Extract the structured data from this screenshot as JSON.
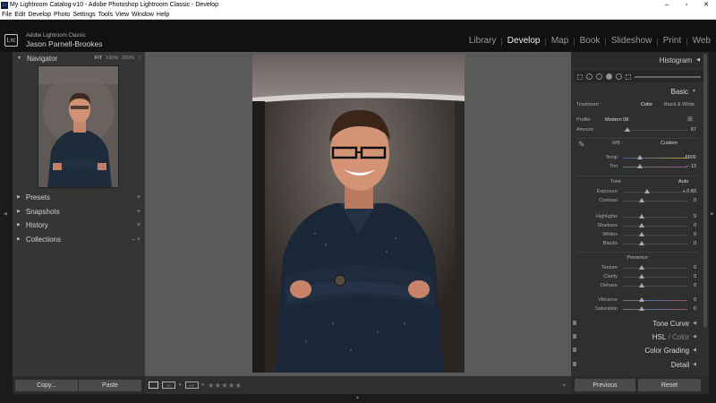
{
  "window": {
    "title": "My Lightroom Catalog-v10 - Adobe Photoshop Lightroom Classic - Develop",
    "app_icon": "Lr",
    "minimize": "–",
    "maximize": "▫",
    "close": "✕"
  },
  "menu": [
    "File",
    "Edit",
    "Develop",
    "Photo",
    "Settings",
    "Tools",
    "View",
    "Window",
    "Help"
  ],
  "identity": {
    "logo": "Lrc",
    "subtitle": "Adobe Lightroom Classic",
    "name": "Jason Parnell-Brookes"
  },
  "modules": [
    "Library",
    "Develop",
    "Map",
    "Book",
    "Slideshow",
    "Print",
    "Web"
  ],
  "modules_active": "Develop",
  "navigator": {
    "title": "Navigator",
    "zoom": [
      "FIT",
      "100%",
      "200%",
      "↕"
    ],
    "zoom_active": "FIT"
  },
  "left_sections": [
    {
      "label": "Presets",
      "action": "+"
    },
    {
      "label": "Snapshots",
      "action": "+"
    },
    {
      "label": "History",
      "action": "×"
    },
    {
      "label": "Collections",
      "action": "– +"
    }
  ],
  "buttons": {
    "copy": "Copy...",
    "paste": "Paste",
    "previous": "Previous",
    "reset": "Reset"
  },
  "toolbar": {
    "stars": "★★★★★"
  },
  "right": {
    "histogram": "Histogram",
    "basic": "Basic",
    "treatment_label": "Treatment :",
    "treatment_color": "Color",
    "treatment_bw": "Black & White",
    "profile_label": "Profile :",
    "profile_value": "Modern 08",
    "amount_label": "Amount",
    "amount_value": "67",
    "wb_label": "WB :",
    "wb_value": "Custom",
    "temp_label": "Temp",
    "temp_value": "6605",
    "tint_label": "Tint",
    "tint_value": "– 13",
    "tone_label": "Tone",
    "auto_label": "Auto",
    "presence_label": "Presence",
    "sliders_tone": [
      {
        "label": "Exposure",
        "value": "+ 0.83",
        "pos": 0.6
      },
      {
        "label": "Contrast",
        "value": "0",
        "pos": 0.5
      }
    ],
    "sliders_tone2": [
      {
        "label": "Highlights",
        "value": "0",
        "pos": 0.5
      },
      {
        "label": "Shadows",
        "value": "0",
        "pos": 0.5
      },
      {
        "label": "Whites",
        "value": "0",
        "pos": 0.5
      },
      {
        "label": "Blacks",
        "value": "0",
        "pos": 0.5
      }
    ],
    "sliders_presence": [
      {
        "label": "Texture",
        "value": "0",
        "pos": 0.5
      },
      {
        "label": "Clarity",
        "value": "0",
        "pos": 0.5
      },
      {
        "label": "Dehaze",
        "value": "0",
        "pos": 0.5
      }
    ],
    "sliders_color": [
      {
        "label": "Vibrance",
        "value": "0",
        "pos": 0.5
      },
      {
        "label": "Saturation",
        "value": "0",
        "pos": 0.5
      }
    ],
    "tone_curve": "Tone Curve",
    "hsl": "HSL",
    "hsl_color": "Color",
    "color_grading": "Color Grading",
    "detail": "Detail"
  },
  "colors": {
    "active_module": "#f0f0f0",
    "panel_bg": "#353535",
    "canvas_bg": "#5a5a5a"
  }
}
